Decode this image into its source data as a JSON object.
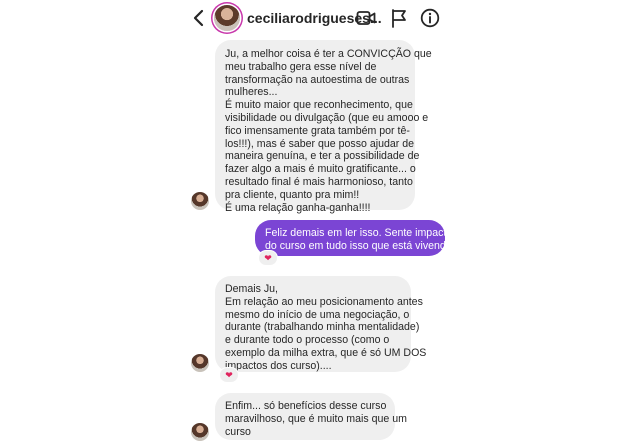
{
  "header": {
    "username": "ceciliarodrigueses..."
  },
  "icons": {
    "back": "chevron-left-icon",
    "video": "video-camera-icon",
    "flag": "flag-icon",
    "info": "info-icon"
  },
  "colors": {
    "outgoing_bubble": "#7b45d4",
    "incoming_bubble": "#efefef",
    "reaction_heart": "#e0245e"
  },
  "messages": [
    {
      "direction": "incoming",
      "lines": [
        "Ju, a melhor coisa é ter a CONVICÇÃO que",
        "meu trabalho gera esse nível de",
        "transformação na autoestima de outras",
        "mulheres...",
        "É muito maior que reconhecimento, que",
        "visibilidade ou divulgação (que eu amooo e",
        "fico imensamente grata também por tê-",
        "los!!!), mas é saber que posso ajudar de",
        "maneira genuína, e ter a possibilidade de",
        "fazer algo a mais é muito gratificante... o",
        "resultado final é mais harmonioso, tanto",
        "pra cliente, quanto pra mim!!",
        "É uma relação ganha-ganha!!!!"
      ]
    },
    {
      "direction": "outgoing",
      "lines": [
        "Feliz demais em ler isso. Sente impactos",
        "do curso em tudo isso que está vivendo?"
      ],
      "reaction": "❤"
    },
    {
      "direction": "incoming",
      "lines": [
        "Demais Ju,",
        "Em relação ao meu posicionamento antes",
        "mesmo do início de uma negociação, o",
        "durante (trabalhando minha mentalidade)",
        "e durante todo o processo (como o",
        "exemplo da milha extra, que é só UM DOS",
        "impactos dos curso)...."
      ],
      "reaction": "❤"
    },
    {
      "direction": "incoming",
      "lines": [
        "Enfim... só benefícios desse curso",
        "maravilhoso, que é muito mais que um",
        "curso"
      ]
    }
  ]
}
